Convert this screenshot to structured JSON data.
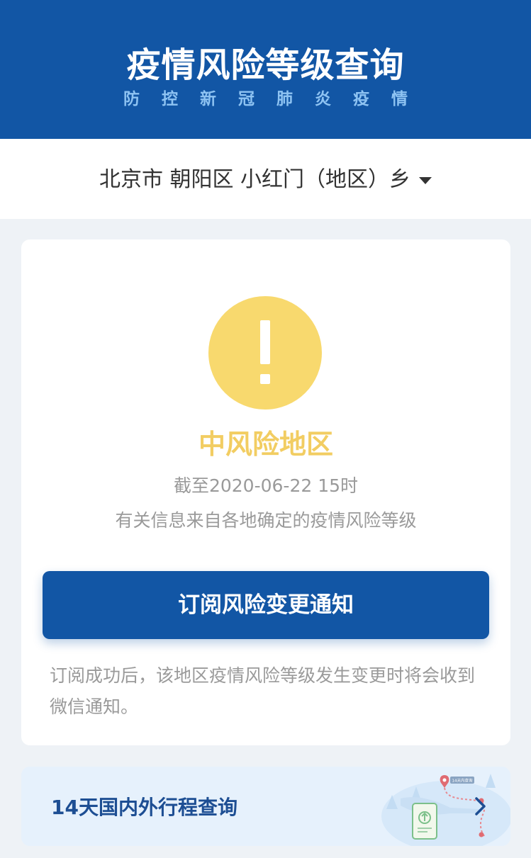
{
  "header": {
    "title": "疫情风险等级查询",
    "subtitle": "防控新冠肺炎疫情"
  },
  "location": {
    "text": "北京市 朝阳区 小红门（地区）乡"
  },
  "risk_card": {
    "level_text": "中风险地区",
    "as_of": "截至2020-06-22 15时",
    "source_note": "有关信息来自各地确定的疫情风险等级",
    "subscribe_button": "订阅风险变更通知",
    "subscribe_desc": "订阅成功后，该地区疫情风险等级发生变更时将会收到微信通知。"
  },
  "itinerary": {
    "label": "14天国内外行程查询",
    "illustration_tag": "14天内查询"
  },
  "colors": {
    "brand_blue": "#1256a5",
    "risk_yellow": "#f8d96e",
    "risk_text_yellow": "#f2cd62"
  },
  "icons": {
    "risk": "exclamation-icon",
    "dropdown": "caret-down-icon",
    "itinerary_arrow": "chevron-right-icon"
  }
}
